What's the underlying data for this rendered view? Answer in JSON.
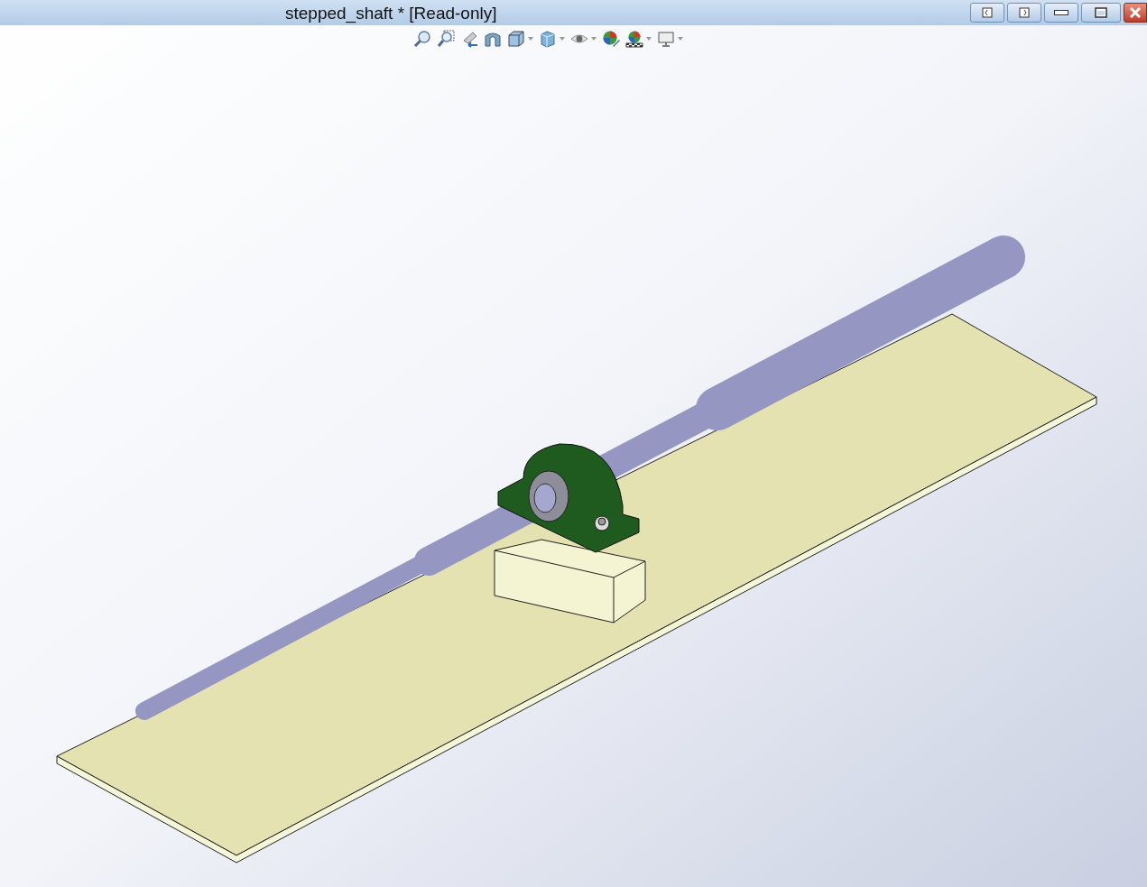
{
  "window": {
    "title": "stepped_shaft * [Read-only]"
  },
  "toolbar": [
    {
      "kind": "zoom-fit",
      "has_menu": false
    },
    {
      "kind": "zoom-area",
      "has_menu": false
    },
    {
      "kind": "previous-view",
      "has_menu": false
    },
    {
      "kind": "section-view",
      "has_menu": false
    },
    {
      "kind": "view-orientation",
      "has_menu": true
    },
    {
      "kind": "display-style",
      "has_menu": true
    },
    {
      "kind": "hide-show",
      "has_menu": true
    },
    {
      "kind": "edit-appearance",
      "has_menu": false
    },
    {
      "kind": "scene",
      "has_menu": true
    },
    {
      "kind": "view-settings",
      "has_menu": true
    }
  ],
  "window_controls": [
    {
      "kind": "pane-left"
    },
    {
      "kind": "pane-right"
    },
    {
      "kind": "minimize"
    },
    {
      "kind": "maximize"
    },
    {
      "kind": "close"
    }
  ]
}
